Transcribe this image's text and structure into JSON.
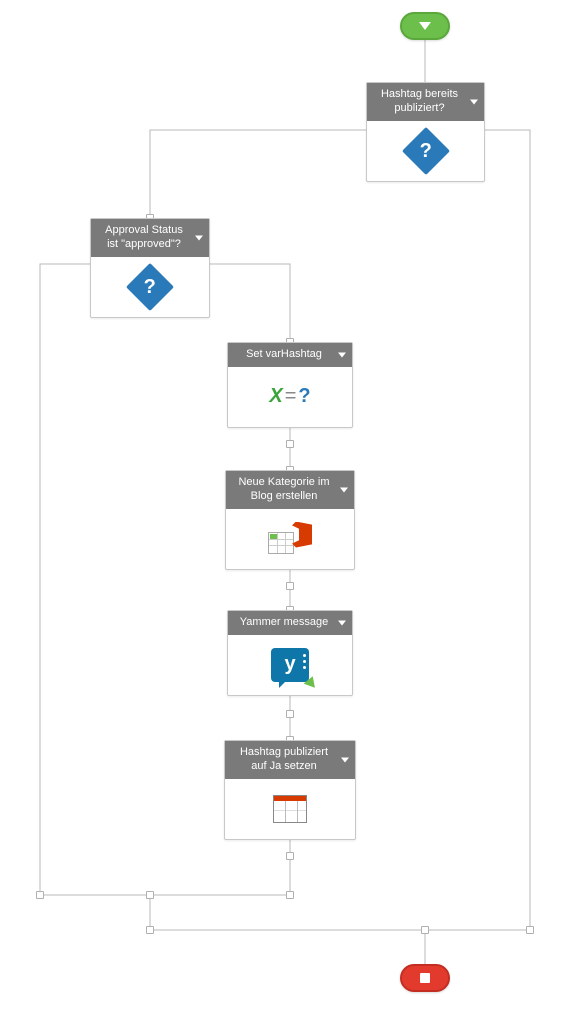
{
  "workflow": {
    "start": {
      "icon": "start-icon"
    },
    "end": {
      "icon": "end-icon"
    },
    "nodes": {
      "cond1": {
        "title": "Hashtag bereits publiziert?",
        "icon": "question-diamond"
      },
      "cond2": {
        "title": "Approval Status ist \"approved\"?",
        "icon": "question-diamond"
      },
      "setvar": {
        "title": "Set varHashtag",
        "icon": "set-variable-icon"
      },
      "createcat": {
        "title": "Neue Kategorie im Blog erstellen",
        "icon": "office-create-icon"
      },
      "yammer": {
        "title": "Yammer message",
        "icon": "yammer-icon"
      },
      "setflag": {
        "title": "Hashtag publiziert auf Ja setzen",
        "icon": "list-update-icon"
      }
    }
  }
}
